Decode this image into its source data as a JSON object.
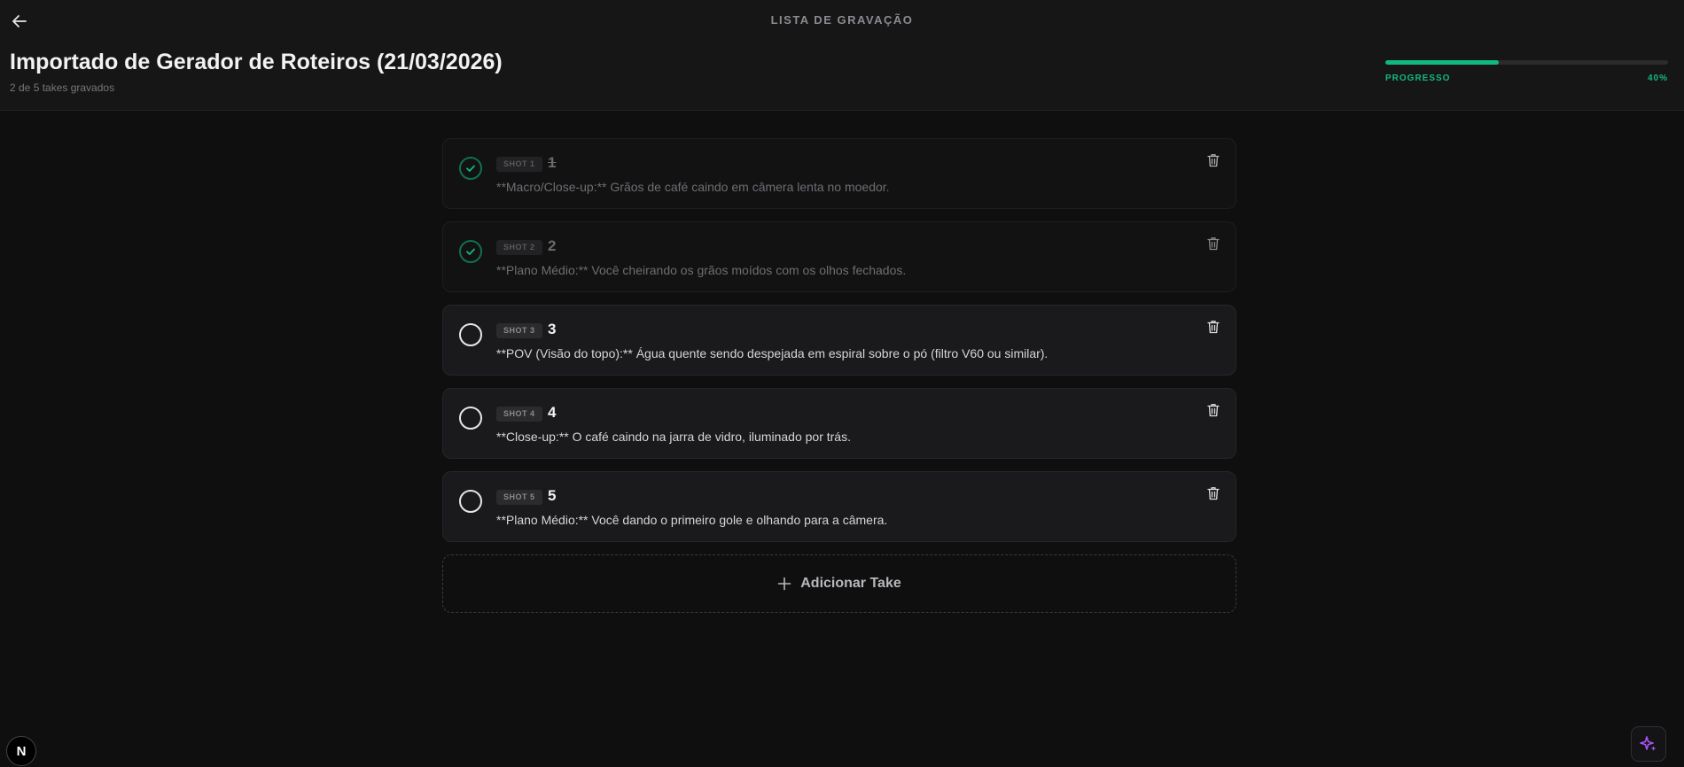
{
  "header": {
    "top_title": "LISTA DE GRAVAÇÃO",
    "title": "Importado de Gerador de Roteiros (21/03/2026)",
    "subtitle": "2 de 5 takes gravados",
    "progress": {
      "label": "PROGRESSO",
      "value_text": "40%",
      "fraction": 0.4,
      "color": "#10b981"
    }
  },
  "takes": [
    {
      "shot_label": "SHOT 1",
      "number": "1",
      "description": "**Macro/Close-up:** Grãos de café caindo em câmera lenta no moedor.",
      "done": true
    },
    {
      "shot_label": "SHOT 2",
      "number": "2",
      "description": "**Plano Médio:** Você cheirando os grãos moídos com os olhos fechados.",
      "done": true
    },
    {
      "shot_label": "SHOT 3",
      "number": "3",
      "description": "**POV (Visão do topo):** Água quente sendo despejada em espiral sobre o pó (filtro V60 ou similar).",
      "done": false
    },
    {
      "shot_label": "SHOT 4",
      "number": "4",
      "description": "**Close-up:** O café caindo na jarra de vidro, iluminado por trás.",
      "done": false
    },
    {
      "shot_label": "SHOT 5",
      "number": "5",
      "description": "**Plano Médio:** Você dando o primeiro gole e olhando para a câmera.",
      "done": false
    }
  ],
  "add_take_label": "Adicionar Take",
  "next_badge_label": "N",
  "icons": {
    "back": "arrow-left-icon",
    "check": "check-icon",
    "trash": "trash-icon",
    "plus": "plus-icon",
    "ai": "sparkles-icon"
  },
  "colors": {
    "accent": "#10b981",
    "done_ring": "#10704f",
    "ai_icon": "#a855f7"
  }
}
